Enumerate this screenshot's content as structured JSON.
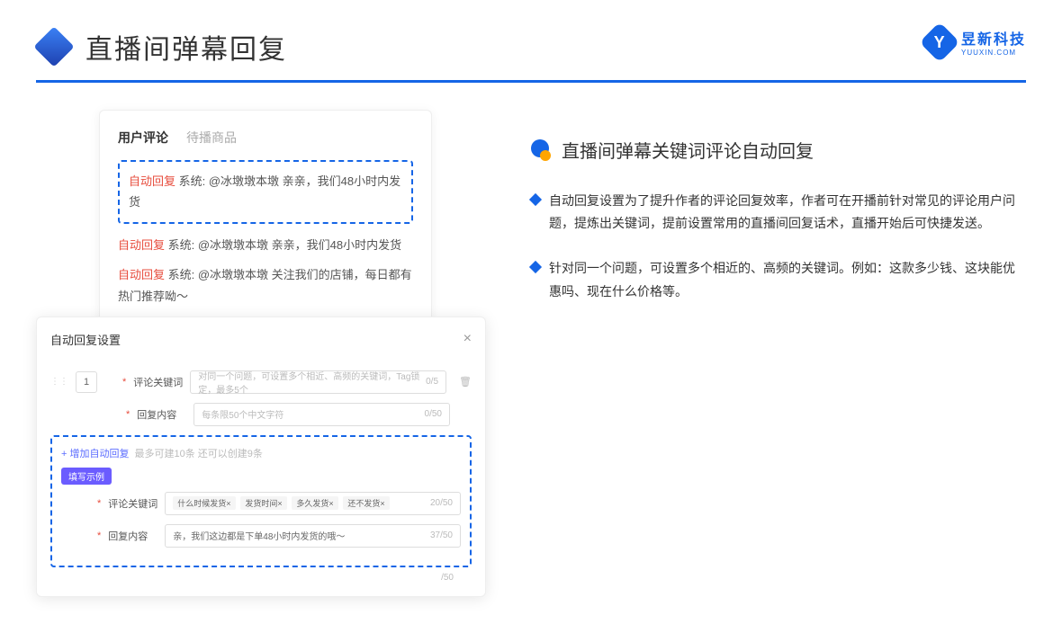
{
  "header": {
    "title": "直播间弹幕回复"
  },
  "brand": {
    "name": "昱新科技",
    "sub": "YUUXIN.COM",
    "letter": "Y"
  },
  "card1": {
    "tab_active": "用户评论",
    "tab_other": "待播商品",
    "tag": "自动回复",
    "line1_sys": "系统: @冰墩墩本墩 亲亲，我们48小时内发货",
    "line2_sys": "系统: @冰墩墩本墩 亲亲，我们48小时内发货",
    "line3_sys": "系统: @冰墩墩本墩 关注我们的店铺，每日都有热门推荐呦～"
  },
  "card2": {
    "title": "自动回复设置",
    "num": "1",
    "label1": "评论关键词",
    "placeholder1": "对同一个问题，可设置多个相近、高频的关键词，Tag锁定，最多5个",
    "counter1": "0/5",
    "label2": "回复内容",
    "placeholder2": "每条限50个中文字符",
    "counter2": "0/50",
    "add_link": "+ 增加自动回复",
    "add_hint": "最多可建10条 还可以创建9条",
    "purple_tag": "填写示例",
    "ex_label1": "评论关键词",
    "tag_a": "什么时候发货×",
    "tag_b": "发货时间×",
    "tag_c": "多久发货×",
    "tag_d": "还不发货×",
    "ex_counter1": "20/50",
    "ex_label2": "回复内容",
    "ex_value2": "亲，我们这边都是下单48小时内发货的哦～",
    "ex_counter2": "37/50",
    "end_counter": "/50"
  },
  "right": {
    "title": "直播间弹幕关键词评论自动回复",
    "bullet1": "自动回复设置为了提升作者的评论回复效率，作者可在开播前针对常见的评论用户问题，提炼出关键词，提前设置常用的直播间回复话术，直播开始后可快捷发送。",
    "bullet2": "针对同一个问题，可设置多个相近的、高频的关键词。例如：这款多少钱、这块能优惠吗、现在什么价格等。"
  }
}
